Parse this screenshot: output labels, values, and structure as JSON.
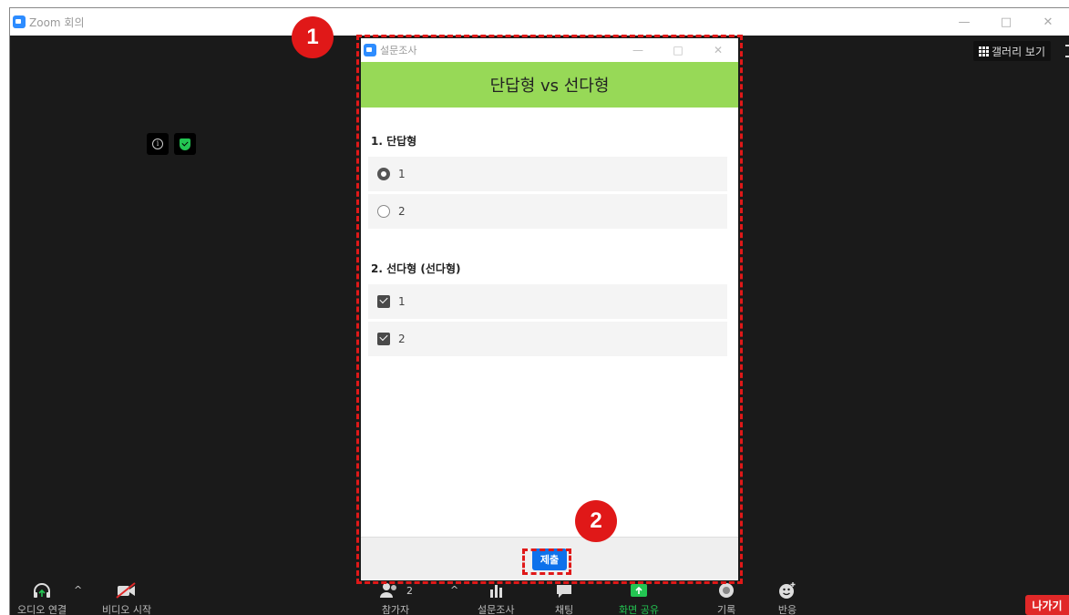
{
  "zoom": {
    "title": "Zoom 회의",
    "controls": [
      "—",
      "□",
      "✕"
    ]
  },
  "gallery_button": "갤러리 보기",
  "survey": {
    "window_title": "설문조사",
    "controls": [
      "—",
      "□",
      "✕"
    ],
    "header": "단답형 vs 선다형",
    "questions": [
      {
        "title": "1. 단답형",
        "type": "radio",
        "options": [
          "1",
          "2"
        ],
        "selected": "1"
      },
      {
        "title": "2. 선다형 (선다형)",
        "type": "checkbox",
        "options": [
          "1",
          "2"
        ],
        "checked": [
          "1",
          "2"
        ]
      }
    ],
    "submit_label": "제출"
  },
  "toolbar": {
    "audio": "오디오 연결",
    "video": "비디오 시작",
    "participants": "참가자",
    "participant_count": "2",
    "poll": "설문조사",
    "chat": "채팅",
    "share": "화면 공유",
    "record": "기록",
    "reactions": "반응",
    "leave": "나가기",
    "caret": "^"
  },
  "annotations": {
    "badge1": "1",
    "badge2": "2"
  },
  "colors": {
    "header_green": "#97d957",
    "submit_blue": "#0e71eb",
    "annotation_red": "#e01818",
    "leave_red": "#e02828"
  }
}
